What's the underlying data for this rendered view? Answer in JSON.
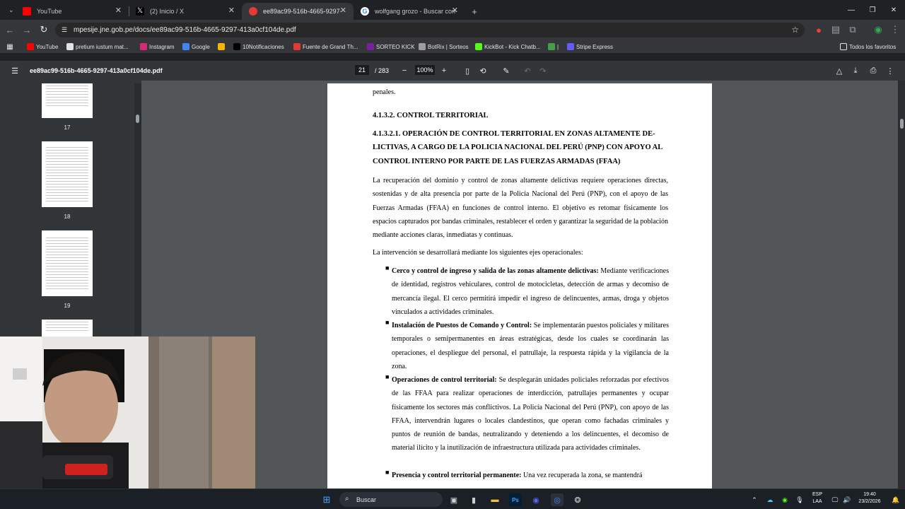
{
  "tabs": [
    {
      "title": "YouTube",
      "active": false
    },
    {
      "title": "(2) Inicio / X",
      "active": false
    },
    {
      "title": "ee89ac99-516b-4665-9297-41",
      "active": true
    },
    {
      "title": "wolfgang grozo - Buscar con G",
      "active": false
    }
  ],
  "new_tab": "+",
  "address": {
    "url": "mpesije.jne.gob.pe/docs/ee89ac99-516b-4665-9297-413a0cf104de.pdf"
  },
  "bookmarks": [
    {
      "label": "YouTube",
      "color": "#ff0000"
    },
    {
      "label": "pretium iustum mat...",
      "color": "#e3e3e3"
    },
    {
      "label": "Instagram",
      "color": "#d62976"
    },
    {
      "label": "Google",
      "color": "#4285f4"
    },
    {
      "label": "",
      "color": "#f4b400"
    },
    {
      "label": "10Notificaciones",
      "color": "#000000"
    },
    {
      "label": "Fuente de Grand Th...",
      "color": "#e53935"
    },
    {
      "label": "SORTEO KICK",
      "color": "#7b1fa2"
    },
    {
      "label": "BotRix | Sorteos",
      "color": "#9e9e9e"
    },
    {
      "label": "KickBot - Kick Chatb...",
      "color": "#53fc18"
    },
    {
      "label": "|",
      "color": "#43a047"
    },
    {
      "label": "Stripe Express",
      "color": "#635bff"
    }
  ],
  "all_bookmarks": "Todos los favoritos",
  "pdf": {
    "filename": "ee89ac99-516b-4665-9297-413a0cf104de.pdf",
    "current_page": "21",
    "total_pages": "/ 283",
    "zoom": "100%"
  },
  "thumbnails": [
    "17",
    "18",
    "19"
  ],
  "doc": {
    "prev_tail": "penales.",
    "h1": "4.1.3.2.    CONTROL TERRITORIAL",
    "h2_l1": "4.1.3.2.1.    OPERACIÓN DE CONTROL TERRITORIAL EN ZONAS ALTAMENTE DE-",
    "h2_l2": "LICTIVAS, A CARGO DE LA POLICIA NACIONAL DEL PERÚ (PNP) CON APOYO AL",
    "h2_l3": "CONTROL INTERNO POR PARTE DE LAS FUERZAS ARMADAS (FFAA)",
    "para1": "La recuperación del dominio y control de zonas altamente delictivas requiere operaciones directas, sostenidas y de alta presencia por parte de la Policía Nacional del Perú (PNP), con el apoyo de  las Fuerzas Armadas (FFAA) en funciones de control interno. El objetivo es retomar físicamente los espacios capturados por bandas criminales, restablecer el orden y garantizar la seguridad de la población mediante acciones claras, inmediatas y continuas.",
    "para2": "La intervención se desarrollará mediante los siguientes ejes operacionales:",
    "bullets": [
      {
        "bold": "Cerco y control de ingreso y salida de las zonas altamente delictivas:",
        "text": " Mediante verificaciones de identidad, registros vehiculares, control de motocicletas, detección de armas y decomiso de mercancía ilegal. El cerco permitirá impedir el ingreso de delincuentes, armas, droga y objetos vinculados a actividades criminales."
      },
      {
        "bold": "Instalación de Puestos de Comando y Control:",
        "text": " Se implementarán puestos policiales y militares temporales o semipermanentes en áreas estratégicas, desde los cuales se coordinarán las operaciones, el despliegue del personal, el patrullaje, la respuesta rápida y la vigilancia de la zona."
      },
      {
        "bold": "Operaciones de control territorial:",
        "text": " Se desplegarán unidades policiales reforzadas por efectivos de las FFAA para realizar operaciones de interdicción, patrullajes permanentes y ocupar físicamente los sectores más conflictivos. La Policía Nacional del Perú (PNP), con apoyo de las FFAA, intervendrán lugares o locales clandestinos, que operan como fachadas criminales y puntos de reunión de bandas, neutralizando y deteniendo a los delincuentes, el decomiso de material ilícito y la inutilización de infraestructura utilizada para actividades criminales."
      },
      {
        "bold": "Presencia y control territorial permanente:",
        "text": " Una vez recuperada la zona, se mantendrá"
      }
    ]
  },
  "taskbar": {
    "search": "Buscar",
    "lang1": "ESP",
    "lang2": "LAA",
    "time": "19:40",
    "date": "23/2/2026"
  }
}
